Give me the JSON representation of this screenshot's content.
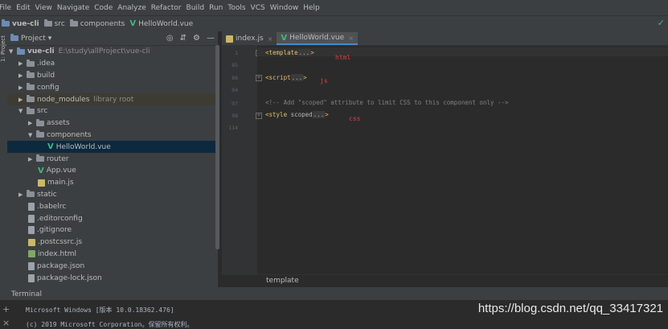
{
  "menu": [
    "File",
    "Edit",
    "View",
    "Navigate",
    "Code",
    "Analyze",
    "Refactor",
    "Build",
    "Run",
    "Tools",
    "VCS",
    "Window",
    "Help"
  ],
  "breadcrumb": {
    "project": "vue-cli",
    "folder1": "src",
    "folder2": "components",
    "file": "HelloWorld.vue"
  },
  "sidebar": {
    "vertical_label": "1: Project"
  },
  "project_panel": {
    "title": "Project"
  },
  "tree": [
    {
      "label": "vue-cli",
      "extra": "E:\\study\\allProject\\vue-cli"
    },
    {
      "label": ".idea"
    },
    {
      "label": "build"
    },
    {
      "label": "config"
    },
    {
      "label": "node_modules",
      "extra": "library root"
    },
    {
      "label": "src"
    },
    {
      "label": "assets"
    },
    {
      "label": "components"
    },
    {
      "label": "HelloWorld.vue"
    },
    {
      "label": "router"
    },
    {
      "label": "App.vue"
    },
    {
      "label": "main.js"
    },
    {
      "label": "static"
    },
    {
      "label": ".babelrc"
    },
    {
      "label": ".editorconfig"
    },
    {
      "label": ".gitignore"
    },
    {
      "label": ".postcssrc.js"
    },
    {
      "label": "index.html"
    },
    {
      "label": "package.json"
    },
    {
      "label": "package-lock.json"
    }
  ],
  "tabs": [
    {
      "label": "index.js"
    },
    {
      "label": "HelloWorld.vue"
    }
  ],
  "code": {
    "lines": [
      "1",
      "85",
      "86",
      "94",
      "97",
      "98",
      "114"
    ],
    "line1_tag": "<template",
    "line1_ell": "...",
    "line1_end": ">",
    "line86_tag": "<script",
    "line86_ell": "...",
    "line86_end": ">",
    "line97": "<!-- Add \"scoped\" attribute to limit CSS to this component only -->",
    "line98_tag": "<style",
    "line98_attr": " scoped",
    "line98_ell": "...",
    "line98_end": ">"
  },
  "annotations": {
    "html": "html",
    "js": "js",
    "css": "css"
  },
  "editor_breadcrumb": "template",
  "terminal": {
    "title": "Terminal",
    "line1": "Microsoft Windows [版本 10.0.18362.476]",
    "line2": "(c) 2019 Microsoft Corporation。保留所有权利。"
  },
  "watermark": "https://blog.csdn.net/qq_33417321"
}
